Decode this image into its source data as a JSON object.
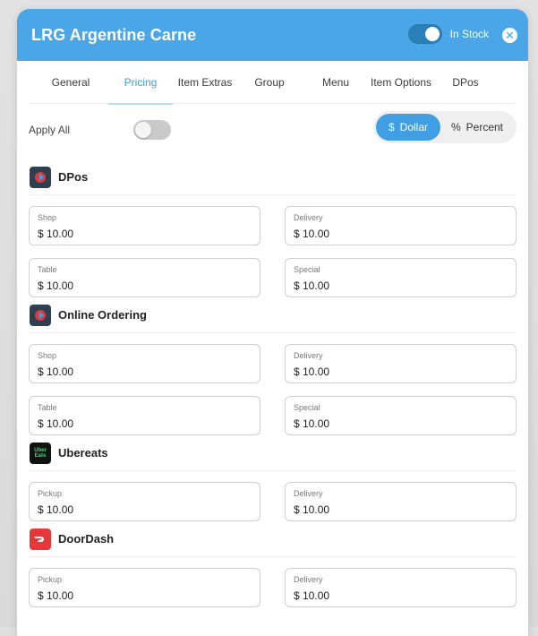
{
  "header": {
    "title": "LRG Argentine Carne",
    "stock_label": "In Stock",
    "close_glyph": "✕"
  },
  "tabs": [
    "General",
    "Pricing",
    "Item Extras",
    "Group",
    "Menu",
    "Item Options",
    "DPos"
  ],
  "active_tab": "Pricing",
  "apply_all": {
    "label": "Apply All",
    "enabled": false
  },
  "price_mode": {
    "dollar_label": "Dollar",
    "dollar_symbol": "$",
    "percent_label": "Percent",
    "percent_symbol": "%",
    "selected": "Dollar"
  },
  "sections": [
    {
      "name": "DPos",
      "fields": [
        {
          "label": "Shop",
          "value": "$ 10.00"
        },
        {
          "label": "Delivery",
          "value": "$ 10.00"
        },
        {
          "label": "Table",
          "value": "$ 10.00"
        },
        {
          "label": "Special",
          "value": "$ 10.00"
        }
      ]
    },
    {
      "name": "Online Ordering",
      "fields": [
        {
          "label": "Shop",
          "value": "$ 10.00"
        },
        {
          "label": "Delivery",
          "value": "$ 10.00"
        },
        {
          "label": "Table",
          "value": "$ 10.00"
        },
        {
          "label": "Special",
          "value": "$ 10.00"
        }
      ]
    },
    {
      "name": "Ubereats",
      "logo_text": "Uber Eats",
      "fields": [
        {
          "label": "Pickup",
          "value": "$ 10.00"
        },
        {
          "label": "Delivery",
          "value": "$ 10.00"
        }
      ]
    },
    {
      "name": "DoorDash",
      "fields": [
        {
          "label": "Pickup",
          "value": "$ 10.00"
        },
        {
          "label": "Delivery",
          "value": "$ 10.00"
        }
      ]
    }
  ],
  "colors": {
    "accent": "#4aa6e6",
    "active_tab": "#3e9bdc",
    "doordash": "#e8373a",
    "dpos": "#2f3f52"
  }
}
